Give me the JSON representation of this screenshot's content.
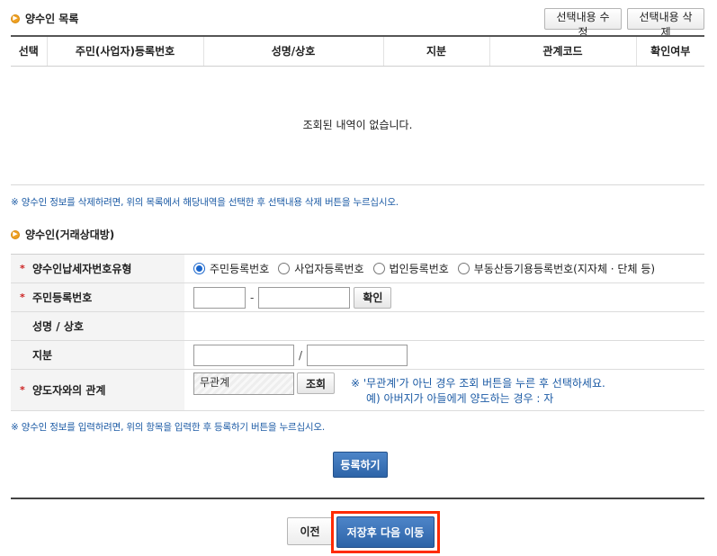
{
  "list_section": {
    "title": "양수인 목록",
    "edit_button": "선택내용 수정",
    "delete_button": "선택내용 삭제",
    "columns": [
      "선택",
      "주민(사업자)등록번호",
      "성명/상호",
      "지분",
      "관계코드",
      "확인여부"
    ],
    "empty_message": "조회된 내역이 없습니다.",
    "note": "※ 양수인 정보를 삭제하려면, 위의 목록에서 해당내역을 선택한 후 선택내용 삭제 버튼을 누르십시오."
  },
  "form_section": {
    "title": "양수인(거래상대방)",
    "rows": {
      "id_type": {
        "label": "양수인납세자번호유형",
        "required": "*",
        "options": [
          "주민등록번호",
          "사업자등록번호",
          "법인등록번호",
          "부동산등기용등록번호(지자체 · 단체 등)"
        ],
        "selected_index": 0
      },
      "resident_no": {
        "label": "주민등록번호",
        "required": "*",
        "separator": "-",
        "first_value": "",
        "second_value": "",
        "confirm_button": "확인"
      },
      "name": {
        "label": "성명 / 상호",
        "value": ""
      },
      "share": {
        "label": "지분",
        "separator": "/",
        "numerator": "",
        "denominator": ""
      },
      "relation": {
        "label": "양도자와의 관계",
        "required": "*",
        "value": "무관계",
        "search_button": "조회",
        "note_line1": "※ '무관계'가 아닌 경우 조회 버튼을 누른 후 선택하세요.",
        "note_line2": "예) 아버지가 아들에게 양도하는 경우 : 자"
      }
    },
    "note": "※ 양수인 정보를 입력하려면, 위의 항목을 입력한 후 등록하기 버튼을 누르십시오.",
    "register_button": "등록하기"
  },
  "footer": {
    "prev_button": "이전",
    "save_next_button": "저장후 다음 이동"
  },
  "colors": {
    "accent_blue": "#2d64a8",
    "note_blue": "#1c5ba5",
    "required_red": "#cc2222",
    "highlight_red": "#ff2a00",
    "bullet_orange": "#f0a020"
  }
}
